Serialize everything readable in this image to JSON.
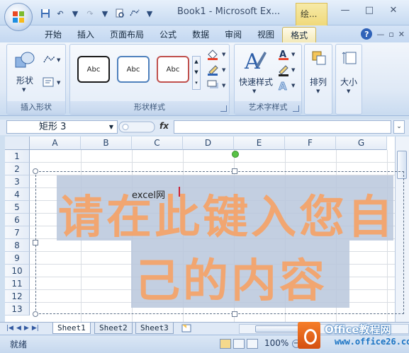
{
  "window": {
    "title": "Book1 - Microsoft Ex...",
    "context_tab": "绘...",
    "controls": [
      "—",
      "□",
      "✕"
    ]
  },
  "ribbon_tabs": [
    "开始",
    "插入",
    "页面布局",
    "公式",
    "数据",
    "审阅",
    "视图",
    "格式"
  ],
  "active_tab": "格式",
  "groups": {
    "insert_shapes": {
      "label": "插入形状",
      "shape_button": "形状"
    },
    "shape_styles": {
      "label": "形状样式",
      "styles": [
        "Abc",
        "Abc",
        "Abc"
      ],
      "style_colors": [
        "#1a1a1a",
        "#4f81bd",
        "#c0504d"
      ]
    },
    "wordart_styles": {
      "label": "艺术字样式",
      "quick_styles": "快速样式"
    },
    "arrange": {
      "label": "排列"
    },
    "size": {
      "label": "大小"
    }
  },
  "formula_bar": {
    "name_box": "矩形 3",
    "fx": "fx",
    "value": ""
  },
  "columns": [
    "A",
    "B",
    "C",
    "D",
    "E",
    "F",
    "G"
  ],
  "rows": [
    "1",
    "2",
    "3",
    "4",
    "5",
    "6",
    "7",
    "8",
    "9",
    "10",
    "11",
    "12",
    "13"
  ],
  "wordart": {
    "line1": "请在此键入您自",
    "line2": "己的内容",
    "typed_text": "excel网",
    "color": "#f4a46c"
  },
  "sheets": [
    "Sheet1",
    "Sheet2",
    "Sheet3"
  ],
  "active_sheet": "Sheet1",
  "status": {
    "text": "就绪",
    "zoom": "100%"
  },
  "watermark": {
    "line1": "Office教程网",
    "line2": "www.office26.com"
  }
}
